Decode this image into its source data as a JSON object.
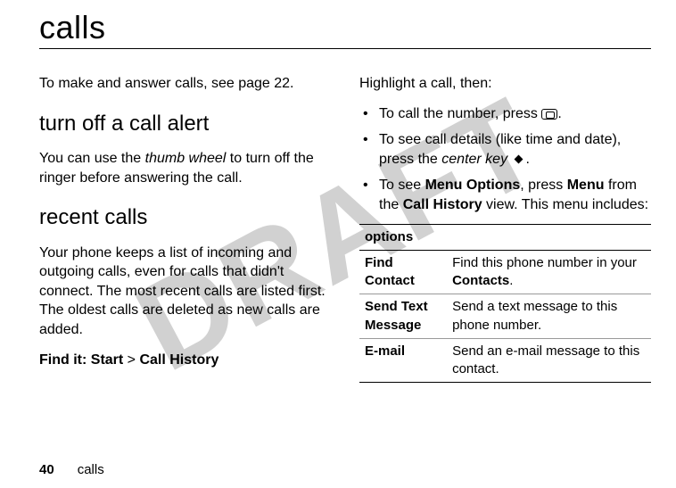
{
  "watermark": "DRAFT",
  "title": "calls",
  "left": {
    "intro": "To make and answer calls, see page 22.",
    "section1_heading": "turn off a call alert",
    "section1_body_a": "You can use the ",
    "section1_body_italic": "thumb wheel",
    "section1_body_b": " to turn off the ringer before answering the call.",
    "section2_heading": "recent calls",
    "section2_body": "Your phone keeps a list of incoming and outgoing calls, even for calls that didn't connect. The most recent calls are listed first. The oldest calls are deleted as new calls are added.",
    "findit_label": "Find it: ",
    "findit_path_a": "Start",
    "findit_sep": " > ",
    "findit_path_b": "Call History"
  },
  "right": {
    "lead": "Highlight a call, then:",
    "b1_a": "To call the number, press ",
    "b1_b": ".",
    "b2_a": "To see call details (like time and date), press the ",
    "b2_italic": "center key",
    "b2_b": ".",
    "b3_a": "To see ",
    "b3_bold1": "Menu Options",
    "b3_b": ", press ",
    "b3_bold2": "Menu",
    "b3_c": " from the ",
    "b3_bold3": "Call History",
    "b3_d": " view. This menu includes:"
  },
  "table": {
    "header": "options",
    "rows": [
      {
        "label": "Find Contact",
        "desc_a": "Find this phone number in your ",
        "desc_bold": "Contacts",
        "desc_b": "."
      },
      {
        "label": "Send Text Message",
        "desc_a": "Send a text message to this phone number.",
        "desc_bold": "",
        "desc_b": ""
      },
      {
        "label": "E-mail",
        "desc_a": "Send an e-mail message to this contact.",
        "desc_bold": "",
        "desc_b": ""
      }
    ]
  },
  "footer": {
    "page": "40",
    "section": "calls"
  }
}
